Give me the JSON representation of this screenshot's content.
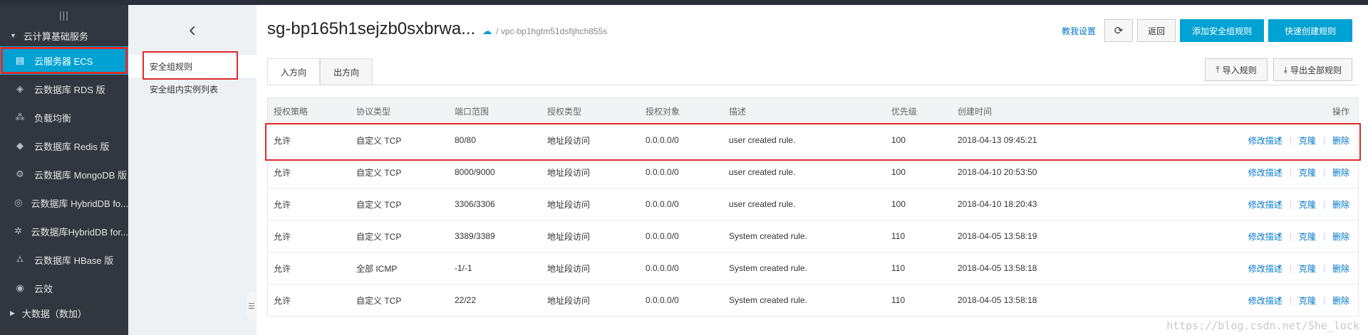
{
  "nav": {
    "handle": "|||",
    "group_top": "云计算基础服务",
    "items": [
      {
        "label": "云服务器 ECS",
        "icon": "server-icon"
      },
      {
        "label": "云数据库 RDS 版",
        "icon": "rds-icon"
      },
      {
        "label": "负载均衡",
        "icon": "load-balancer-icon"
      },
      {
        "label": "云数据库 Redis 版",
        "icon": "redis-icon"
      },
      {
        "label": "云数据库 MongoDB 版",
        "icon": "mongodb-icon"
      },
      {
        "label": "云数据库 HybridDB fo...",
        "icon": "hybriddb-icon"
      },
      {
        "label": "云数据库HybridDB for...",
        "icon": "hybriddb-network-icon"
      },
      {
        "label": "云数据库 HBase 版",
        "icon": "hbase-icon"
      },
      {
        "label": "云效",
        "icon": "yunxiao-icon"
      }
    ],
    "group_bottom": "大数据（数加）"
  },
  "subnav": {
    "items": [
      "安全组规则",
      "安全组内实例列表"
    ]
  },
  "header": {
    "title": "sg-bp165h1sejzb0sxbrwa...",
    "vpc": "/ vpc-bp1hgtm51dsfijhch855s",
    "help_link": "教我设置",
    "back_label": "返回",
    "add_rule_label": "添加安全组规则",
    "quick_rule_label": "快速创建规则"
  },
  "tabs": [
    "入方向",
    "出方向"
  ],
  "toolbar2": {
    "import_label": "导入规则",
    "export_label": "导出全部规则"
  },
  "table": {
    "columns": [
      "授权策略",
      "协议类型",
      "端口范围",
      "授权类型",
      "授权对象",
      "描述",
      "优先级",
      "创建时间",
      "操作"
    ],
    "ops": [
      "修改描述",
      "克隆",
      "删除"
    ],
    "rows": [
      {
        "policy": "允许",
        "protocol": "自定义 TCP",
        "port": "80/80",
        "auth_type": "地址段访问",
        "object": "0.0.0.0/0",
        "desc": "user created rule.",
        "priority": "100",
        "created": "2018-04-13 09:45:21"
      },
      {
        "policy": "允许",
        "protocol": "自定义 TCP",
        "port": "8000/9000",
        "auth_type": "地址段访问",
        "object": "0.0.0.0/0",
        "desc": "user created rule.",
        "priority": "100",
        "created": "2018-04-10 20:53:50"
      },
      {
        "policy": "允许",
        "protocol": "自定义 TCP",
        "port": "3306/3306",
        "auth_type": "地址段访问",
        "object": "0.0.0.0/0",
        "desc": "user created rule.",
        "priority": "100",
        "created": "2018-04-10 18:20:43"
      },
      {
        "policy": "允许",
        "protocol": "自定义 TCP",
        "port": "3389/3389",
        "auth_type": "地址段访问",
        "object": "0.0.0.0/0",
        "desc": "System created rule.",
        "priority": "110",
        "created": "2018-04-05 13:58:19"
      },
      {
        "policy": "允许",
        "protocol": "全部 ICMP",
        "port": "-1/-1",
        "auth_type": "地址段访问",
        "object": "0.0.0.0/0",
        "desc": "System created rule.",
        "priority": "110",
        "created": "2018-04-05 13:58:18"
      },
      {
        "policy": "允许",
        "protocol": "自定义 TCP",
        "port": "22/22",
        "auth_type": "地址段访问",
        "object": "0.0.0.0/0",
        "desc": "System created rule.",
        "priority": "110",
        "created": "2018-04-05 13:58:18"
      }
    ]
  },
  "watermark": "https://blog.csdn.net/She_lock",
  "colors": {
    "accent": "#00a2d3",
    "nav_bg": "#32373f",
    "link": "#0077c8",
    "highlight": "#e02b2b"
  }
}
